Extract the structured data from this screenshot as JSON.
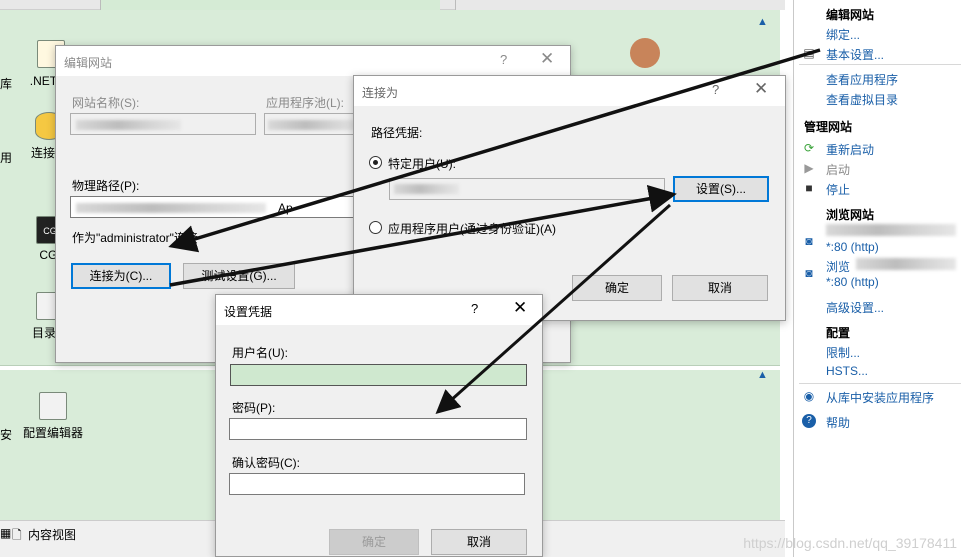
{
  "features": {
    "net": ".NET 错",
    "conn_string": "连接字",
    "use": "用",
    "cgi": "CGI",
    "dir": "目录浏",
    "install": "安",
    "config_editor": "配置编辑器"
  },
  "statusbar": {
    "content_view": "内容视图"
  },
  "actions": {
    "edit_site_header": "编辑网站",
    "binding": "绑定...",
    "basic_settings": "基本设置...",
    "view_apps": "查看应用程序",
    "view_vdirs": "查看虚拟目录",
    "manage_site_header": "管理网站",
    "restart": "重新启动",
    "start": "启动",
    "stop": "停止",
    "browse_site_header": "浏览网站",
    "browse_prefix": "浏览",
    "browse_port1": "*:80 (http)",
    "browse_port2": "*:80 (http)",
    "advanced_settings": "高级设置...",
    "config_header": "配置",
    "limits": "限制...",
    "hsts": "HSTS...",
    "install_from_gallery": "从库中安装应用程序",
    "help": "帮助"
  },
  "edit_site_dialog": {
    "title": "编辑网站",
    "help": "?",
    "close": "✕",
    "site_name_label": "网站名称(S):",
    "app_pool_label": "应用程序池(L):",
    "physical_path_label": "物理路径(P):",
    "path_suffix": "Ap",
    "connect_as_text": "作为\"administrator\"连接",
    "connect_as_button": "连接为(C)...",
    "test_settings_button": "测试设置(G)..."
  },
  "connect_as_dialog": {
    "title": "连接为",
    "help": "?",
    "close": "✕",
    "path_credentials_label": "路径凭据:",
    "specific_user_label": "特定用户(U):",
    "set_button": "设置(S)...",
    "app_user_label": "应用程序用户(通过身份验证)(A)",
    "ok_button": "确定",
    "cancel_button": "取消"
  },
  "set_credentials_dialog": {
    "title": "设置凭据",
    "help": "?",
    "close": "✕",
    "username_label": "用户名(U):",
    "username_value": "",
    "password_label": "密码(P):",
    "password_value": "",
    "confirm_password_label": "确认密码(C):",
    "confirm_password_value": "",
    "ok_button": "确定",
    "cancel_button": "取消"
  },
  "watermark": "https://blog.csdn.net/qq_39178411",
  "colors": {
    "accent": "#0078d7",
    "link": "#1a5fa8",
    "iis_green": "#d9ecd9",
    "arrow": "#111111"
  }
}
